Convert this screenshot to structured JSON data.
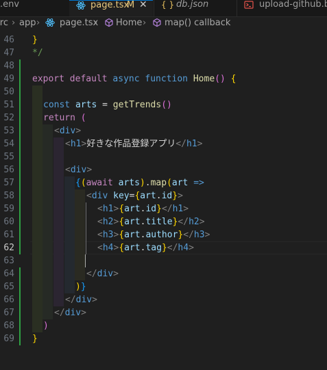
{
  "tabs": [
    {
      "label": ".env",
      "icon": "gear-icon"
    },
    {
      "label": "page.tsx",
      "modified": "M",
      "close": "✕",
      "icon": "react-icon",
      "active": true
    },
    {
      "label": "db.json",
      "icon": "json-braces-icon"
    },
    {
      "label": "upload-github.bat",
      "icon": "terminal-icon"
    }
  ],
  "breadcrumb": {
    "items": [
      "src",
      "app",
      "page.tsx",
      "Home",
      "map() callback"
    ],
    "separator": "›"
  },
  "editor": {
    "current_line": 62,
    "lines": [
      {
        "n": "46",
        "text": "}"
      },
      {
        "n": "47",
        "text": "*/"
      },
      {
        "n": "48",
        "text": ""
      },
      {
        "n": "49",
        "text": "export default async function Home() {"
      },
      {
        "n": "50",
        "text": ""
      },
      {
        "n": "51",
        "text": "const arts = getTrends()"
      },
      {
        "n": "52",
        "text": "return ("
      },
      {
        "n": "53",
        "text": "<div>"
      },
      {
        "n": "54",
        "text": "<h1>好きな作品登録アプリ</h1>"
      },
      {
        "n": "55",
        "text": ""
      },
      {
        "n": "56",
        "text": "<div>"
      },
      {
        "n": "57",
        "text": "{(await arts).map(art =>"
      },
      {
        "n": "58",
        "text": "<div key={art.id}>"
      },
      {
        "n": "59",
        "text": "<h1>{art.id}</h1>"
      },
      {
        "n": "60",
        "text": "<h2>{art.title}</h2>"
      },
      {
        "n": "61",
        "text": "<h3>{art.author}</h3>"
      },
      {
        "n": "62",
        "text": "<h4>{art.tag}</h4>"
      },
      {
        "n": "63",
        "text": ""
      },
      {
        "n": "64",
        "text": "</div>"
      },
      {
        "n": "65",
        "text": ")}"
      },
      {
        "n": "66",
        "text": "</div>"
      },
      {
        "n": "67",
        "text": "</div>"
      },
      {
        "n": "68",
        "text": ")"
      },
      {
        "n": "69",
        "text": "}"
      }
    ]
  },
  "colors": {
    "editor_bg": "#1f1f1f",
    "keyword": "#569cd6",
    "control": "#c586c0",
    "function": "#dcdcaa",
    "variable": "#9cdcfe",
    "bracket_gold": "#ffd700",
    "bracket_orchid": "#da70d6",
    "bracket_blue": "#179fff",
    "modified_tab": "#e8c87e",
    "gutter_added": "#2ea043"
  }
}
